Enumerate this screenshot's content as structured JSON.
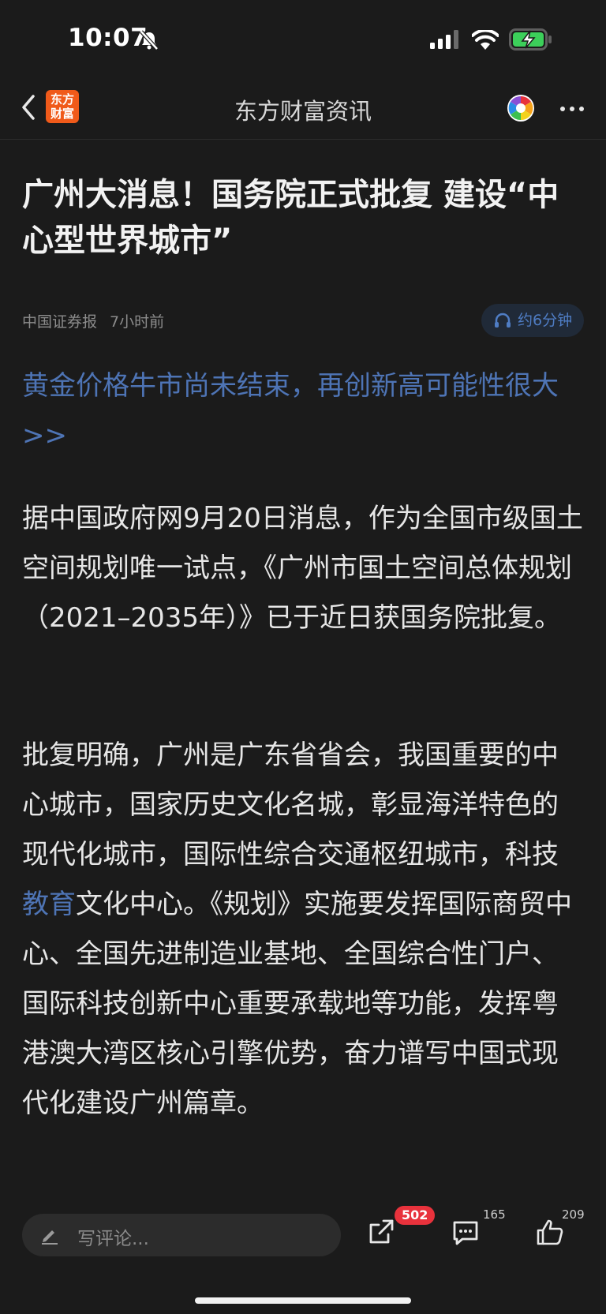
{
  "status_bar": {
    "time": "10:07"
  },
  "nav": {
    "logo_text": "东方财富",
    "title": "东方财富资讯"
  },
  "article": {
    "headline": "广州大消息！国务院正式批复 建设“中心型世界城市”",
    "source": "中国证券报",
    "time_ago": "7小时前",
    "audio_label": "约6分钟",
    "promo_link": "黄金价格牛市尚未结束，再创新高可能性很大>>",
    "para1": "据中国政府网9月20日消息，作为全国市级国土空间规划唯一试点，《广州市国土空间总体规划（2021–2035年）》已于近日获国务院批复。",
    "para2_before": "批复明确，广州是广东省省会，我国重要的中心城市，国家历史文化名城，彰显海洋特色的现代化城市，国际性综合交通枢纽城市，科技",
    "para2_link": "教育",
    "para2_after": "文化中心。《规划》实施要发挥国际商贸中心、全国先进制造业基地、全国综合性门户、国际科技创新中心重要承载地等功能，发挥粤港澳大湾区核心引擎优势，奋力谱写中国式现代化建设广州篇章。"
  },
  "bottom_bar": {
    "comment_placeholder": "写评论...",
    "share_badge": "502",
    "comment_count": "165",
    "like_count": "209"
  },
  "colors": {
    "accent_link": "#4e74b5",
    "logo_bg": "#f05a1a",
    "badge": "#e8323c"
  }
}
